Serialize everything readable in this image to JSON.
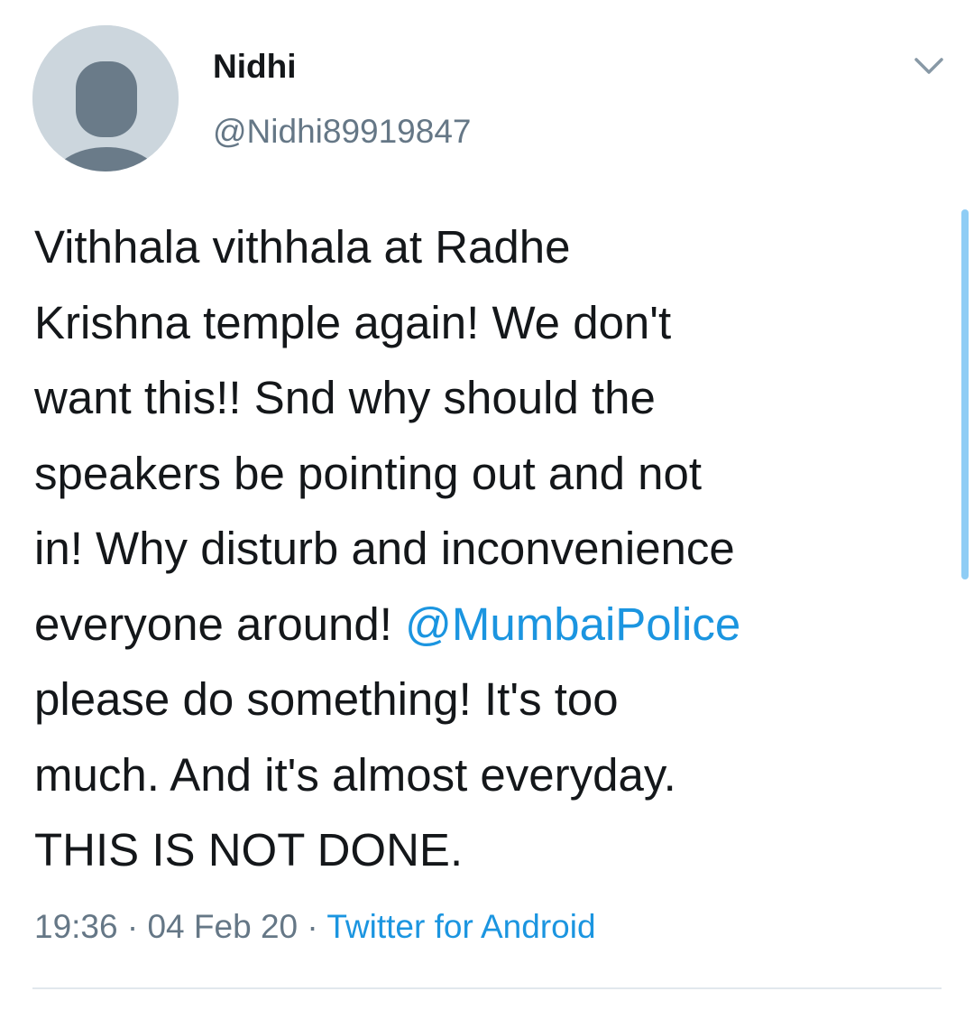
{
  "author": {
    "name": "Nidhi",
    "handle": "@Nidhi89919847",
    "avatar_icon": "default-profile-icon"
  },
  "menu_icon": "chevron-down-icon",
  "tweet": {
    "line1": "Vithhala vithhala at Radhe",
    "line2": "Krishna temple again! We don't",
    "line3": "want this!! Snd why should the",
    "line4": "speakers be pointing out and not",
    "line5": "in! Why disturb and inconvenience",
    "line6_text": "everyone around! ",
    "mention": "@MumbaiPolice",
    "line7": "please do something! It's too",
    "line8": "much. And it's almost everyday.",
    "line9": "THIS IS NOT DONE."
  },
  "meta": {
    "time": "19:36",
    "separator1": " · ",
    "date": "04 Feb 20",
    "separator2": " · ",
    "source": "Twitter for Android"
  },
  "colors": {
    "text": "#14171a",
    "secondary": "#657786",
    "link": "#1b95e0",
    "avatar_bg": "#ccd6dd",
    "scrollbar": "#8fcdf5",
    "divider": "#e1e8ed"
  }
}
